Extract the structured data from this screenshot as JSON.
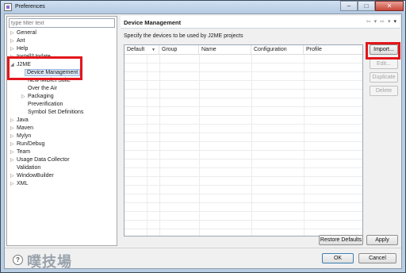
{
  "window": {
    "title": "Preferences",
    "controls": {
      "minimize": "–",
      "maximize": "□",
      "close": "✕"
    }
  },
  "filter": {
    "placeholder": "type filter text"
  },
  "tree": {
    "items": [
      {
        "label": "General",
        "twisty": "▷"
      },
      {
        "label": "Ant",
        "twisty": "▷"
      },
      {
        "label": "Help",
        "twisty": "▷"
      },
      {
        "label": "Install/Update",
        "twisty": "▷"
      },
      {
        "label": "J2ME",
        "twisty": "◢"
      },
      {
        "label": "Device Management",
        "twisty": ""
      },
      {
        "label": "New MIDlet Suite",
        "twisty": ""
      },
      {
        "label": "Over the Air",
        "twisty": ""
      },
      {
        "label": "Packaging",
        "twisty": "▷"
      },
      {
        "label": "Preverification",
        "twisty": ""
      },
      {
        "label": "Symbol Set Definitions",
        "twisty": ""
      },
      {
        "label": "Java",
        "twisty": "▷"
      },
      {
        "label": "Maven",
        "twisty": "▷"
      },
      {
        "label": "Mylyn",
        "twisty": "▷"
      },
      {
        "label": "Run/Debug",
        "twisty": "▷"
      },
      {
        "label": "Team",
        "twisty": "▷"
      },
      {
        "label": "Usage Data Collector",
        "twisty": "▷"
      },
      {
        "label": "Validation",
        "twisty": ""
      },
      {
        "label": "WindowBuilder",
        "twisty": "▷"
      },
      {
        "label": "XML",
        "twisty": "▷"
      }
    ]
  },
  "page": {
    "title": "Device Management",
    "description": "Specify the devices to be used by J2ME projects",
    "nav": {
      "back": "⇦",
      "back_menu": "▾",
      "forward": "⇨",
      "forward_menu": "▾",
      "menu": "▾"
    }
  },
  "table": {
    "columns": [
      "Default",
      "Group",
      "Name",
      "Configuration",
      "Profile"
    ],
    "rows": []
  },
  "buttons": {
    "import": "Import...",
    "edit": "Edit...",
    "duplicate": "Duplicate",
    "delete": "Delete",
    "restore_defaults": "Restore Defaults",
    "apply": "Apply",
    "ok": "OK",
    "cancel": "Cancel"
  },
  "help_icon": "?",
  "watermark": "噗技場",
  "colors": {
    "highlight": "#e3161c",
    "selection": "#dbe8f7"
  }
}
